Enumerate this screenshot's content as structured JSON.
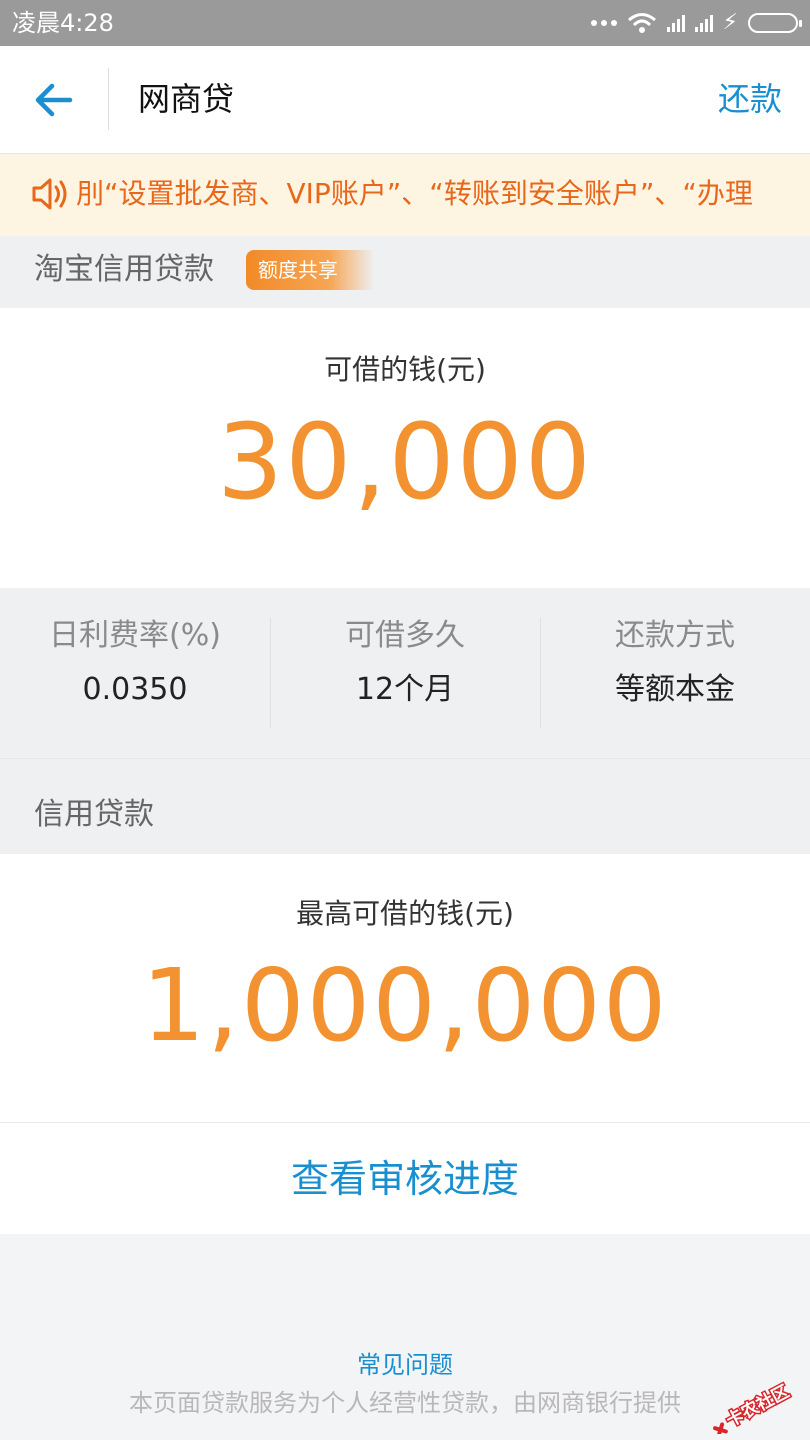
{
  "status_bar": {
    "time": "凌晨4:28",
    "icons": [
      "more-dots-icon",
      "wifi-icon",
      "signal-icon",
      "signal-icon",
      "charging-icon",
      "battery-icon"
    ]
  },
  "nav": {
    "title": "网商贷",
    "back_icon": "back-arrow-icon",
    "repay_label": "还款"
  },
  "notice": {
    "icon": "speaker-icon",
    "text": "刖“设置批发商、VIP账户”、“转账到安全账户”、“办理"
  },
  "taobao_section": {
    "label": "淘宝信用贷款",
    "badge": "额度共享"
  },
  "taobao_card": {
    "amount_label": "可借的钱(元)",
    "amount_value": "30,000"
  },
  "loan_terms": [
    {
      "label": "日利费率(%)",
      "value": "0.0350"
    },
    {
      "label": "可借多久",
      "value": "12个月"
    },
    {
      "label": "还款方式",
      "value": "等额本金"
    }
  ],
  "credit_section": {
    "label": "信用贷款"
  },
  "credit_card": {
    "amount_label": "最高可借的钱(元)",
    "amount_value": "1,000,000"
  },
  "action": {
    "label": "查看审核进度"
  },
  "footer": {
    "faq_label": "常见问题",
    "disclaimer": "本页面贷款服务为个人经营性贷款，由网商银行提供"
  },
  "watermark": {
    "text": "卡农社区"
  },
  "colors": {
    "accent_blue": "#1a8fcf",
    "amount_orange": "#f29230",
    "notice_orange": "#e8671a",
    "notice_bg": "#fdf4e1",
    "badge_orange": "#f28a27"
  }
}
